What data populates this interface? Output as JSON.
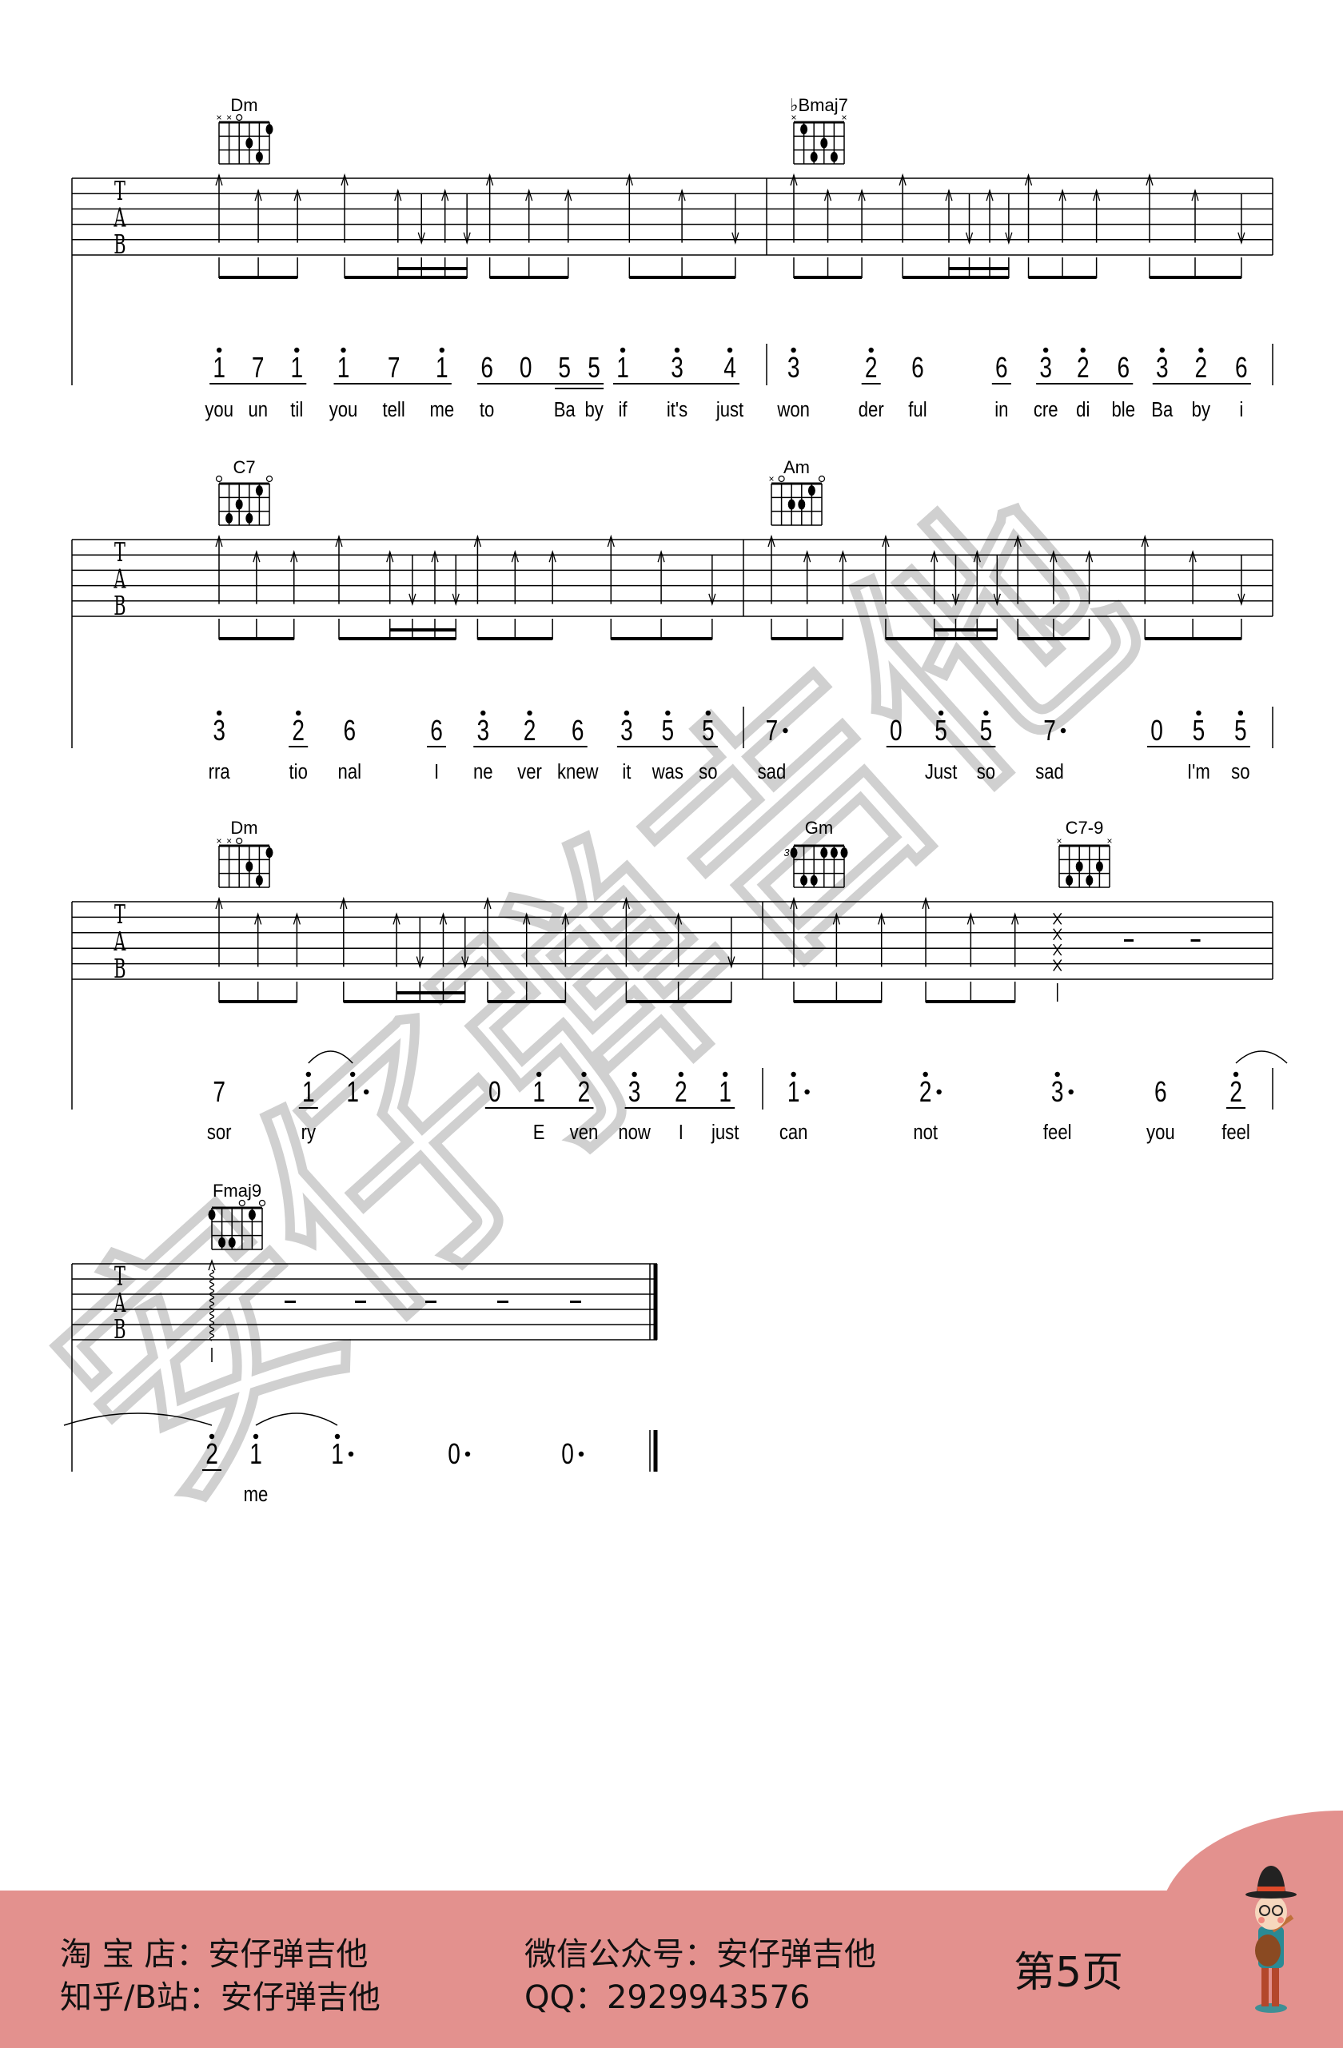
{
  "watermark": "安仔弹吉他",
  "tab_letters": [
    "T",
    "A",
    "B"
  ],
  "systems": [
    {
      "chords": [
        {
          "name": "Dm",
          "markers": [
            "x",
            "x",
            "o",
            "",
            "",
            ""
          ],
          "dots": [
            [
              6,
              1
            ],
            [
              4,
              2
            ],
            [
              5,
              3
            ]
          ]
        },
        {
          "name": "♭Bmaj7",
          "markers": [
            "x",
            "",
            "",
            "",
            "",
            "x"
          ],
          "dots": [
            [
              2,
              1
            ],
            [
              4,
              2
            ],
            [
              3,
              3
            ],
            [
              5,
              3
            ]
          ]
        }
      ],
      "notes": [
        {
          "n": "1",
          "h": 1,
          "g": 1,
          "l": "you"
        },
        {
          "n": "7",
          "g": 1,
          "l": "un"
        },
        {
          "n": "1",
          "h": 1,
          "g": 1,
          "l": "til"
        },
        {
          "n": "1",
          "h": 1,
          "g": 2,
          "l": "you"
        },
        {
          "n": "7",
          "g": 2,
          "l": "tell"
        },
        {
          "n": "1",
          "h": 1,
          "g": 2,
          "l": "me"
        },
        {
          "n": "6",
          "g": 3,
          "l": "to"
        },
        {
          "n": "0",
          "g": 3,
          "l": ""
        },
        {
          "n": "5",
          "g": 3,
          "u": 2,
          "l": "Ba"
        },
        {
          "n": "5",
          "g": 3,
          "u": 2,
          "l": "by"
        },
        {
          "n": "1",
          "h": 1,
          "g": 4,
          "l": "if"
        },
        {
          "n": "3",
          "h": 1,
          "g": 4,
          "l": "it's"
        },
        {
          "n": "4",
          "h": 1,
          "g": 4,
          "l": "just"
        },
        {
          "n": "3",
          "h": 1,
          "l": "won"
        },
        {
          "n": "2",
          "h": 1,
          "g": 5,
          "l": "der"
        },
        {
          "n": "6",
          "l": "ful"
        },
        {
          "n": "6",
          "g": 6,
          "l": "in"
        },
        {
          "n": "3",
          "h": 1,
          "g": 7,
          "l": "cre"
        },
        {
          "n": "2",
          "h": 1,
          "g": 7,
          "l": "di"
        },
        {
          "n": "6",
          "g": 7,
          "l": "ble"
        },
        {
          "n": "3",
          "h": 1,
          "g": 8,
          "l": "Ba"
        },
        {
          "n": "2",
          "h": 1,
          "g": 8,
          "l": "by"
        },
        {
          "n": "6",
          "g": 8,
          "l": "i"
        }
      ],
      "ties": []
    },
    {
      "chords": [
        {
          "name": "C7",
          "markers": [
            "o",
            "",
            "",
            "",
            "",
            "o"
          ],
          "dots": [
            [
              5,
              1
            ],
            [
              3,
              2
            ],
            [
              2,
              3
            ],
            [
              4,
              3
            ]
          ]
        },
        {
          "name": "Am",
          "markers": [
            "x",
            "o",
            "",
            "",
            "",
            "o"
          ],
          "dots": [
            [
              5,
              1
            ],
            [
              3,
              2
            ],
            [
              4,
              2
            ]
          ]
        }
      ],
      "notes": [
        {
          "n": "3",
          "h": 1,
          "l": "rra"
        },
        {
          "n": "2",
          "h": 1,
          "g": 1,
          "l": "tio"
        },
        {
          "n": "6",
          "l": "nal"
        },
        {
          "n": "6",
          "g": 2,
          "l": "I"
        },
        {
          "n": "3",
          "h": 1,
          "g": 3,
          "l": "ne"
        },
        {
          "n": "2",
          "h": 1,
          "g": 3,
          "l": "ver"
        },
        {
          "n": "6",
          "g": 3,
          "l": "knew"
        },
        {
          "n": "3",
          "h": 1,
          "g": 4,
          "l": "it"
        },
        {
          "n": "5",
          "h": 1,
          "g": 4,
          "l": "was"
        },
        {
          "n": "5",
          "h": 1,
          "g": 4,
          "l": "so"
        },
        {
          "n": "7",
          "d": true,
          "l": "sad"
        },
        {
          "n": "0",
          "g": 5,
          "l": ""
        },
        {
          "n": "5",
          "h": 1,
          "g": 5,
          "l": "Just"
        },
        {
          "n": "5",
          "h": 1,
          "g": 5,
          "l": "so"
        },
        {
          "n": "7",
          "d": true,
          "l": "sad"
        },
        {
          "n": "0",
          "g": 6,
          "l": ""
        },
        {
          "n": "5",
          "h": 1,
          "g": 6,
          "l": "I'm"
        },
        {
          "n": "5",
          "h": 1,
          "g": 6,
          "l": "so"
        }
      ],
      "ties": []
    },
    {
      "chords": [
        {
          "name": "Dm",
          "markers": [
            "x",
            "x",
            "o",
            "",
            "",
            ""
          ],
          "dots": [
            [
              6,
              1
            ],
            [
              4,
              2
            ],
            [
              5,
              3
            ]
          ]
        },
        {
          "name": "Gm",
          "fret": "3",
          "markers": [
            "",
            "",
            "",
            "",
            "",
            ""
          ],
          "dots": [
            [
              1,
              1
            ],
            [
              4,
              1
            ],
            [
              5,
              1
            ],
            [
              6,
              1
            ],
            [
              2,
              3
            ],
            [
              3,
              3
            ]
          ]
        },
        {
          "name": "C7-9",
          "markers": [
            "x",
            "",
            "",
            "",
            "",
            "x"
          ],
          "dots": [
            [
              3,
              2
            ],
            [
              5,
              2
            ],
            [
              2,
              3
            ],
            [
              4,
              3
            ]
          ]
        }
      ],
      "notes": [
        {
          "n": "7",
          "l": "sor"
        },
        {
          "n": "1",
          "h": 1,
          "g": 1,
          "l": "ry"
        },
        {
          "n": "1",
          "h": 1,
          "d": true,
          "l": ""
        },
        {
          "n": "0",
          "g": 2,
          "l": ""
        },
        {
          "n": "1",
          "h": 1,
          "g": 2,
          "l": "E"
        },
        {
          "n": "2",
          "h": 1,
          "g": 2,
          "l": "ven"
        },
        {
          "n": "3",
          "h": 1,
          "g": 3,
          "l": "now"
        },
        {
          "n": "2",
          "h": 1,
          "g": 3,
          "l": "I"
        },
        {
          "n": "1",
          "h": 1,
          "g": 3,
          "l": "just"
        },
        {
          "n": "1",
          "h": 1,
          "d": true,
          "l": "can"
        },
        {
          "n": "2",
          "h": 1,
          "d": true,
          "l": "not"
        },
        {
          "n": "3",
          "h": 1,
          "d": true,
          "l": "feel"
        },
        {
          "n": "6",
          "l": "you"
        },
        {
          "n": "2",
          "h": 1,
          "g": 4,
          "l": "feel"
        }
      ],
      "ties": [
        [
          1,
          2
        ],
        [
          13,
          null
        ]
      ]
    },
    {
      "chords": [
        {
          "name": "Fmaj9",
          "markers": [
            "",
            "",
            "",
            "o",
            "",
            "o"
          ],
          "dots": [
            [
              1,
              1
            ],
            [
              5,
              1
            ],
            [
              2,
              3
            ],
            [
              3,
              3
            ]
          ]
        }
      ],
      "notes": [
        {
          "n": "2",
          "h": 1,
          "g": 1,
          "l": ""
        },
        {
          "n": "1",
          "h": 1,
          "l": "me"
        },
        {
          "n": "1",
          "h": 1,
          "d": true,
          "l": ""
        },
        {
          "n": "0",
          "d": true,
          "l": ""
        },
        {
          "n": "0",
          "d": true,
          "l": ""
        }
      ],
      "ties": [
        [
          null,
          0
        ],
        [
          1,
          2
        ]
      ]
    }
  ],
  "footer": {
    "taobao": "淘 宝 店：安仔弹吉他",
    "zhihu": "知乎/B站：安仔弹吉他",
    "wechat": "微信公众号：安仔弹吉他",
    "qq": "QQ：2929943576",
    "page": "第5页",
    "color": "#e3918e"
  }
}
